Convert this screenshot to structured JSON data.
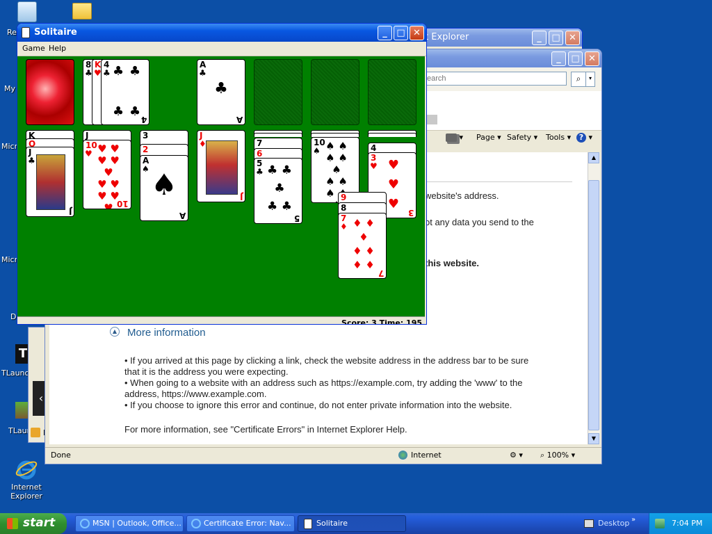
{
  "desktop": {
    "icons": [
      {
        "label": "Re"
      },
      {
        "label": ""
      },
      {
        "label": "My"
      },
      {
        "label": "Micro C"
      },
      {
        "label": "Micro B"
      },
      {
        "label": "D"
      },
      {
        "label": "TLaunc"
      },
      {
        "label": "TLaun"
      },
      {
        "label": "Internet Explorer"
      }
    ]
  },
  "ie_back": {
    "title": "t Explorer"
  },
  "ie_front": {
    "search_placeholder": "earch",
    "commands": {
      "page": "Page",
      "safety": "Safety",
      "tools": "Tools"
    },
    "content": {
      "line1": "website's address.",
      "line2": "ot any data you send to the",
      "line3": "this website.",
      "more_info": "More information",
      "bullet1a": "If you arrived at this page by clicking a link, check the website address in the address bar to be sure",
      "bullet1b": "that it is the address you were expecting.",
      "bullet2a": "When going to a website with an address such as https://example.com, try adding the 'www' to the",
      "bullet2b": "address, https://www.example.com.",
      "bullet3": "If you choose to ignore this error and continue, do not enter private information into the website.",
      "footer": "For more information, see \"Certificate Errors\" in Internet Explorer Help."
    },
    "status": {
      "left": "Done",
      "zone": "Internet",
      "zoom": "100%"
    },
    "side_stub": "H"
  },
  "solitaire": {
    "title": "Solitaire",
    "menu": {
      "game": "Game",
      "help": "Help"
    },
    "score_text": "Score: 3 Time: 195",
    "waste": [
      {
        "rank": "8",
        "suit": "♣"
      },
      {
        "rank": "K",
        "suit": "♥"
      },
      {
        "rank": "4",
        "suit": "♣"
      }
    ],
    "foundations": [
      {
        "rank": "A",
        "suit": "♣"
      }
    ],
    "tableau": [
      {
        "hidden": [
          "K",
          "Q",
          "J"
        ],
        "top": {
          "rank": "J",
          "suit": "♣",
          "face": "J"
        }
      },
      {
        "hidden": [
          "J"
        ],
        "top": {
          "rank": "10",
          "suit": "♥"
        }
      },
      {
        "hidden": [
          "3",
          "2"
        ],
        "top": {
          "rank": "A",
          "suit": "♠"
        }
      },
      {
        "hidden": [],
        "top": {
          "rank": "J",
          "suit": "♦",
          "face": "J"
        }
      },
      {
        "hidden": [
          "7",
          "6"
        ],
        "top": {
          "rank": "5",
          "suit": "♣"
        }
      },
      {
        "hidden": [],
        "top": {
          "rank": "10",
          "suit": "♠"
        }
      },
      {
        "hidden": [
          "4"
        ],
        "top": {
          "rank": "3",
          "suit": "♥"
        }
      }
    ],
    "dragging": [
      {
        "rank": "9"
      },
      {
        "rank": "8"
      },
      {
        "rank": "7",
        "suit": "♦"
      }
    ]
  },
  "taskbar": {
    "start_label": "start",
    "tasks": [
      {
        "label": "MSN | Outlook, Office..."
      },
      {
        "label": "Certificate Error: Nav..."
      },
      {
        "label": "Solitaire"
      }
    ],
    "desktop_label": "Desktop",
    "clock": "7:04 PM"
  },
  "colors": {
    "felt": "#008000",
    "xp_blue": "#0857e1",
    "taskbar": "#245edc"
  }
}
